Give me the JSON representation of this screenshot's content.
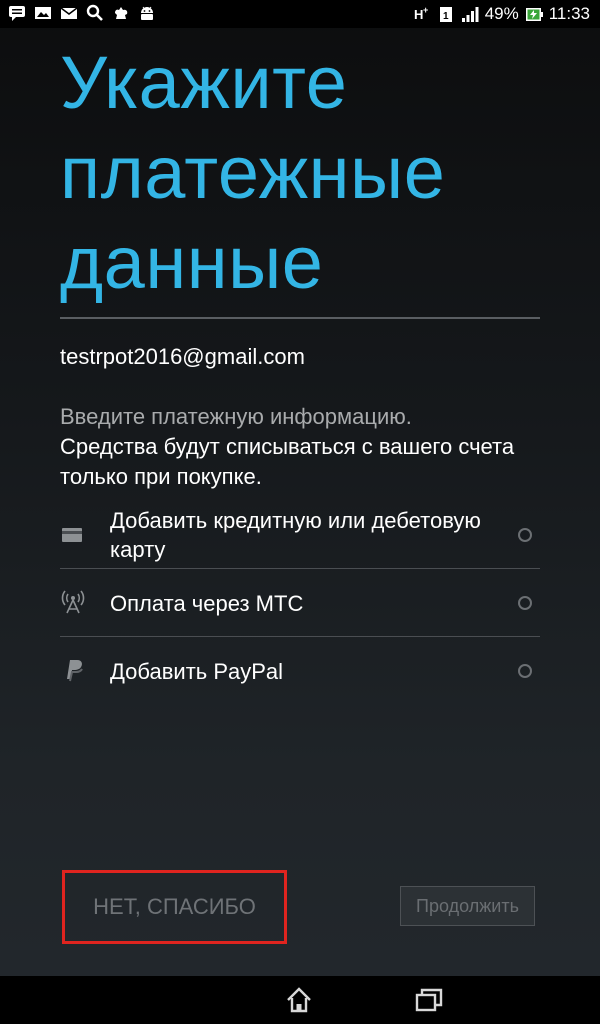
{
  "status_bar": {
    "icons_left": [
      "chat-icon",
      "image-icon",
      "mail-icon",
      "search-icon",
      "puzzle-icon",
      "android-icon"
    ],
    "icons_right": [
      "hplus-icon",
      "sim-icon",
      "signal-icon",
      "battery-charging-icon"
    ],
    "battery": "49%",
    "time": "11:33"
  },
  "title": {
    "line1": "Укажите",
    "line2": "платежные",
    "line3": "данные"
  },
  "account": {
    "email": "testrpot2016@gmail.com"
  },
  "info": {
    "line1": "Введите платежную информацию.",
    "line2": "Средства будут списываться с вашего счета только при покупке."
  },
  "options": [
    {
      "label": "Добавить кредитную или дебетовую карту",
      "icon": "credit-card-icon",
      "selected": false
    },
    {
      "label": "Оплата через МТС",
      "icon": "antenna-icon",
      "selected": false
    },
    {
      "label": "Добавить PayPal",
      "icon": "paypal-icon",
      "selected": false
    }
  ],
  "buttons": {
    "no_thanks": "НЕТ, СПАСИБО",
    "continue": "Продолжить"
  },
  "colors": {
    "accent": "#33b5e5",
    "highlight": "#e0241f"
  },
  "nav_bar": {
    "icons": [
      "home-icon",
      "recent-apps-icon"
    ]
  }
}
